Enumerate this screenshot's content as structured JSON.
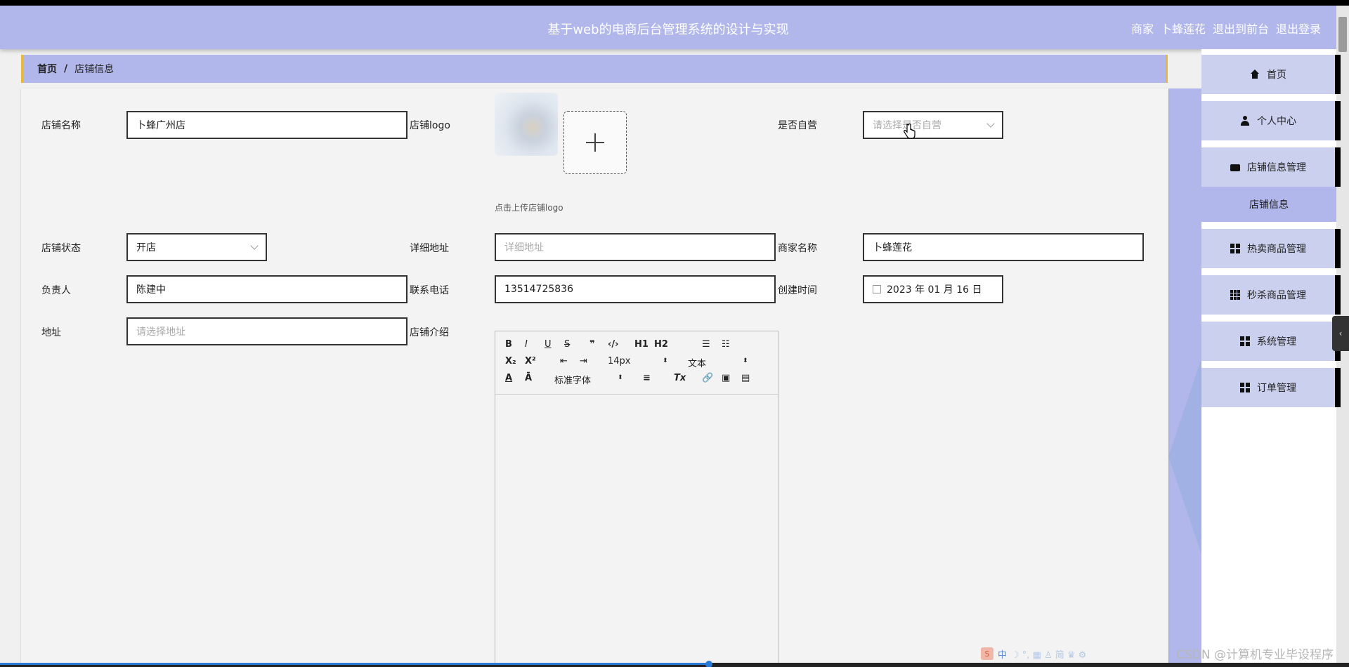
{
  "header": {
    "title": "基于web的电商后台管理系统的设计与实现",
    "role": "商家",
    "username": "卜蜂莲花",
    "back_to_front": "退出到前台",
    "logout": "退出登录"
  },
  "breadcrumb": {
    "home": "首页",
    "separator": "/",
    "current": "店铺信息"
  },
  "form": {
    "shop_name": {
      "label": "店铺名称",
      "value": "卜蜂广州店"
    },
    "shop_logo": {
      "label": "店铺logo",
      "hint": "点击上传店铺logo"
    },
    "self_operated": {
      "label": "是否自营",
      "placeholder": "请选择是否自营"
    },
    "shop_status": {
      "label": "店铺状态",
      "value": "开店"
    },
    "detail_address": {
      "label": "详细地址",
      "placeholder": "详细地址"
    },
    "merchant_name": {
      "label": "商家名称",
      "value": "卜蜂莲花"
    },
    "manager": {
      "label": "负责人",
      "value": "陈建中"
    },
    "phone": {
      "label": "联系电话",
      "value": "13514725836"
    },
    "created_time": {
      "label": "创建时间",
      "value": "2023 年 01 月 16 日"
    },
    "address": {
      "label": "地址",
      "placeholder": "请选择地址"
    },
    "intro": {
      "label": "店铺介绍"
    }
  },
  "editor": {
    "bold": "B",
    "italic": "I",
    "underline": "U",
    "strike": "S",
    "quote": "❞",
    "code": "‹/›",
    "h1": "H1",
    "h2": "H2",
    "ordered": "☰",
    "bullet": "☷",
    "sub": "X₂",
    "sup": "X²",
    "outdent": "⇤",
    "indent": "⇥",
    "font_size": "14px",
    "header_select": "文本",
    "color": "A",
    "background": "Ā",
    "font_family": "标准字体",
    "align": "≡",
    "clear": "Tx",
    "link": "🔗",
    "image": "▣",
    "video": "▤",
    "updown": "⬍"
  },
  "sidebar": {
    "items": [
      {
        "label": "首页",
        "icon": "home-icon"
      },
      {
        "label": "个人中心",
        "icon": "user-icon"
      },
      {
        "label": "店铺信息管理",
        "icon": "wallet-icon"
      },
      {
        "label": "热卖商品管理",
        "icon": "grid-icon"
      },
      {
        "label": "秒杀商品管理",
        "icon": "grid9-icon"
      },
      {
        "label": "系统管理",
        "icon": "grid-icon"
      },
      {
        "label": "订单管理",
        "icon": "grid-icon"
      }
    ],
    "sub_item": "店铺信息",
    "collapse": "‹"
  },
  "watermark": "CSDN @计算机专业毕设程序",
  "ime": {
    "logo": "S",
    "zh": "中",
    "icons": "☽ °, ▦ ♙ 简 ♛ ⚙"
  },
  "colors": {
    "header_bg": "#b1b7ea",
    "accent": "#e6b83a",
    "card_bg": "#f3f3f3"
  }
}
